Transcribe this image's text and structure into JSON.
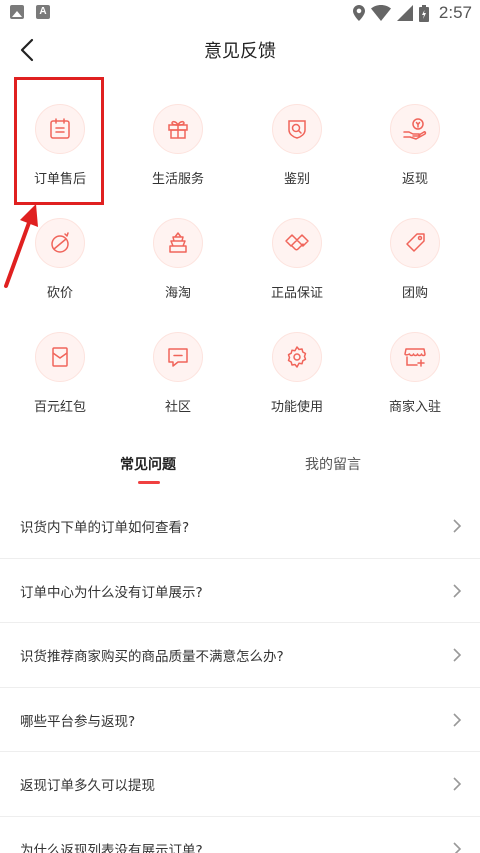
{
  "status_bar": {
    "time": "2:57"
  },
  "header": {
    "title": "意见反馈"
  },
  "categories": [
    {
      "label": "订单售后",
      "icon": "order-calendar-icon"
    },
    {
      "label": "生活服务",
      "icon": "gift-box-icon"
    },
    {
      "label": "鉴别",
      "icon": "search-shield-icon"
    },
    {
      "label": "返现",
      "icon": "coin-hand-icon"
    },
    {
      "label": "砍价",
      "icon": "tag-slash-icon"
    },
    {
      "label": "海淘",
      "icon": "temple-icon"
    },
    {
      "label": "正品保证",
      "icon": "handshake-icon"
    },
    {
      "label": "团购",
      "icon": "price-tag-icon"
    },
    {
      "label": "百元红包",
      "icon": "red-envelope-icon"
    },
    {
      "label": "社区",
      "icon": "chat-bubble-icon"
    },
    {
      "label": "功能使用",
      "icon": "gear-icon"
    },
    {
      "label": "商家入驻",
      "icon": "storefront-icon"
    }
  ],
  "tabs": {
    "faq": "常见问题",
    "my_messages": "我的留言"
  },
  "faq": [
    "识货内下单的订单如何查看?",
    "订单中心为什么没有订单展示?",
    "识货推荐商家购买的商品质量不满意怎么办?",
    "哪些平台参与返现?",
    "返现订单多久可以提现",
    "为什么返现列表没有展示订单?"
  ],
  "colors": {
    "accent": "#f04040",
    "icon_stroke": "#f0645a",
    "icon_bg": "#fff3f1",
    "annotation_red": "#e02020"
  }
}
